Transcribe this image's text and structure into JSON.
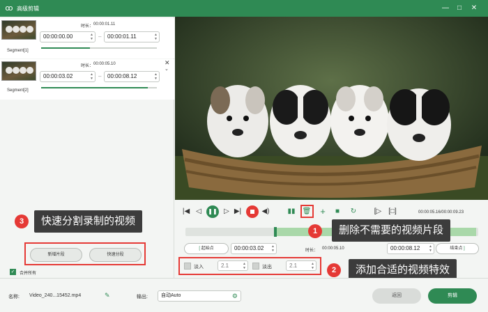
{
  "titlebar": {
    "title": "高级剪辑",
    "logo_icon": "ꝏ"
  },
  "segments": [
    {
      "label": "Segment[1]",
      "duration_label": "时长：",
      "duration": "00:00:01.11",
      "start": "00:00:00.00",
      "end": "00:00:01.11",
      "progress": 0.42
    },
    {
      "label": "Segment[2]",
      "duration_label": "时长：",
      "duration": "00:00:05.10",
      "start": "00:00:03.02",
      "end": "00:00:08.12",
      "progress": 0.92
    }
  ],
  "player": {
    "time": "00:00:05.16/00:00:09.23"
  },
  "trim": {
    "start_btn": "起始点",
    "start_value": "00:00:03.02",
    "duration_label": "时长：",
    "duration_value": "00:00:05.10",
    "end_value": "00:00:08.12",
    "end_btn": "结束点"
  },
  "effects": {
    "fade_in_label": "淡入",
    "fade_in_value": "2.1",
    "fade_out_label": "淡出",
    "fade_out_value": "2.1"
  },
  "left_actions": {
    "new_segment": "新增片段",
    "quick_split": "快速分段",
    "merge_all": "合并所有"
  },
  "callouts": {
    "c1": {
      "num": "1",
      "text": "删除不需要的视频片段"
    },
    "c2": {
      "num": "2",
      "text": "添加合适的视频特效"
    },
    "c3": {
      "num": "3",
      "text": "快速分割录制的视频"
    }
  },
  "footer": {
    "name_label": "名称:",
    "name_value": "Video_240...15452.mp4",
    "output_label": "输出:",
    "output_value": "自动Auto",
    "back_btn": "返回",
    "edit_btn": "剪辑"
  },
  "colors": {
    "accent": "#2f8a54",
    "highlight": "#e53935",
    "callout_bg": "#3c3c3c"
  }
}
